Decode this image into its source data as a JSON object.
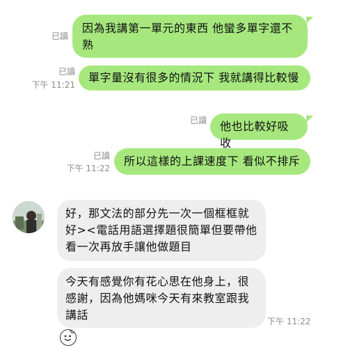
{
  "messages": [
    {
      "direction": "out",
      "read": "已讀",
      "time": "",
      "text": "因為我講第一單元的東西 他蠻多單字還不熟"
    },
    {
      "direction": "out",
      "read": "已讀",
      "time": "下午 11:21",
      "text": "單字量沒有很多的情況下 我就講得比較慢"
    },
    {
      "direction": "out",
      "read": "已讀",
      "time": "",
      "text": "他也比較好吸收"
    },
    {
      "direction": "out",
      "read": "已讀",
      "time": "下午 11:22",
      "text": "所以這樣的上課速度下 看似不排斥"
    },
    {
      "direction": "in",
      "time": "",
      "text": "好，那文法的部分先一次一個框框就好><電話用語選擇題很簡單但要帶他看一次再放手讓他做題目"
    },
    {
      "direction": "in",
      "time": "下午 11:22",
      "text": "今天有感覺你有花心思在他身上，很感謝，因為他媽咪今天有來教室跟我講話"
    }
  ],
  "icons": {
    "avatar": "contact-avatar",
    "emoji": "emoji-sticker-icon"
  },
  "colors": {
    "outgoing_bubble": "#a6e87e",
    "incoming_bubble": "#eeeeee",
    "meta_text": "#8a8a8a"
  }
}
